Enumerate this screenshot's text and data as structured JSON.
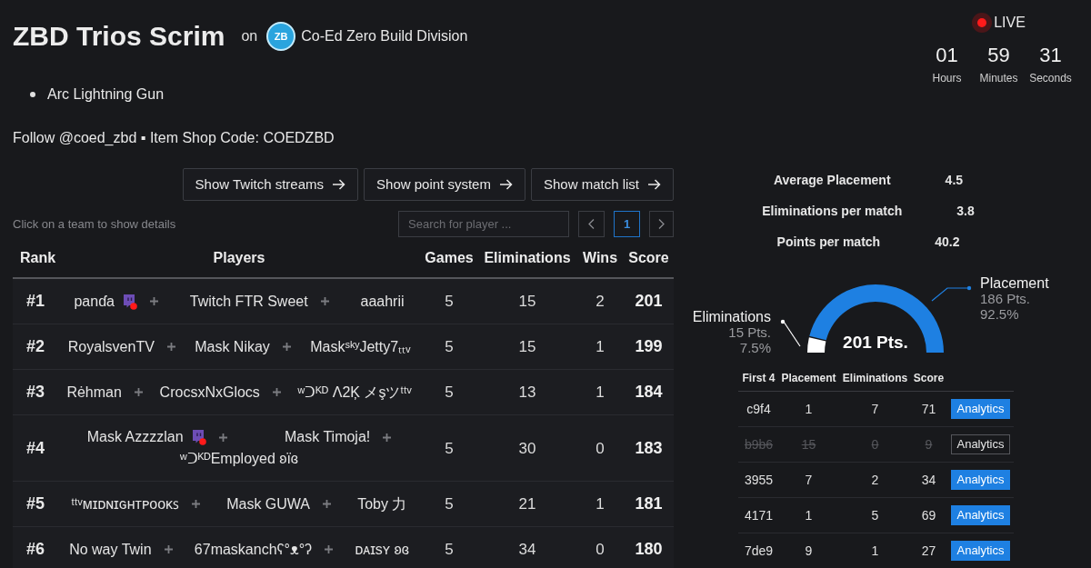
{
  "header": {
    "title": "ZBD Trios Scrim",
    "connector": "on",
    "organizer": {
      "logo_text": "ZB",
      "name": "Co-Ed Zero Build Division"
    }
  },
  "live": {
    "label": "LIVE"
  },
  "countdown": [
    {
      "value": "01",
      "unit": "Hours"
    },
    {
      "value": "59",
      "unit": "Minutes"
    },
    {
      "value": "31",
      "unit": "Seconds"
    }
  ],
  "notes": [
    "Arc Lightning Gun"
  ],
  "follow_line": "Follow @coed_zbd ▪ Item Shop Code: COEDZBD",
  "actions": [
    "Show Twitch streams",
    "Show point system",
    "Show match list"
  ],
  "hint": "Click on a team to show details",
  "search": {
    "placeholder": "Search for player ..."
  },
  "pagination": [
    {
      "label": "1",
      "selected": true
    }
  ],
  "leaderboard": {
    "columns": [
      "Rank",
      "Players",
      "Games",
      "Eliminations",
      "Wins",
      "Score"
    ],
    "rows": [
      {
        "rank": "#1",
        "players": [
          {
            "name": "panɗa",
            "live": true
          },
          {
            "name": "Twitch FTR Sweet",
            "live": false
          },
          {
            "name": "aaahrii",
            "live": false
          }
        ],
        "games": "5",
        "eliminations": "15",
        "wins": "2",
        "score": "201"
      },
      {
        "rank": "#2",
        "players": [
          {
            "name": "RoyalsvenTV",
            "live": false
          },
          {
            "name": "Mask Nikay",
            "live": false
          },
          {
            "name": "MaskˢᵏʸJetty7ₜₜᵥ",
            "live": false
          }
        ],
        "games": "5",
        "eliminations": "15",
        "wins": "1",
        "score": "199"
      },
      {
        "rank": "#3",
        "players": [
          {
            "name": "Rėhman",
            "live": false
          },
          {
            "name": "CrocsxNxGlocs",
            "live": false
          },
          {
            "name": "ʷᑐᴷᴰ Λ2Ķ メşツᵗᵗᵛ",
            "live": false
          }
        ],
        "games": "5",
        "eliminations": "13",
        "wins": "1",
        "score": "184"
      },
      {
        "rank": "#4",
        "players": [
          {
            "name": "Mask Azzzzlan",
            "live": true
          },
          {
            "name": "Mask Timoja!",
            "live": false
          },
          {
            "name": "ʷᑐᴷᴰEmployed ʚïɞ",
            "live": false
          }
        ],
        "games": "5",
        "eliminations": "30",
        "wins": "0",
        "score": "183"
      },
      {
        "rank": "#5",
        "players": [
          {
            "name": "ᵗᵗᵛᴍɪᴅɴɪɢʜᴛᴘᴏᴏᴋꜱ",
            "live": false
          },
          {
            "name": "Mask GUWA",
            "live": false
          },
          {
            "name": "Toby 力",
            "live": false
          }
        ],
        "games": "5",
        "eliminations": "21",
        "wins": "1",
        "score": "181"
      },
      {
        "rank": "#6",
        "players": [
          {
            "name": "No way Twin",
            "live": false
          },
          {
            "name": "67maskanchʕ°ᴥ°ʔ",
            "live": false
          },
          {
            "name": "ᴅᴀɪsʏ ʚɞ",
            "live": false
          }
        ],
        "games": "5",
        "eliminations": "34",
        "wins": "0",
        "score": "180"
      }
    ]
  },
  "team_stats": [
    {
      "label": "Average Placement",
      "value": "4.5"
    },
    {
      "label": "Eliminations per match",
      "value": "3.8"
    },
    {
      "label": "Points per match",
      "value": "40.2"
    }
  ],
  "score_chart": {
    "total": "201 Pts.",
    "callouts": [
      {
        "points": "15 Pts.",
        "share": "7.5%",
        "color": "#ffffff"
      },
      {
        "points": "186 Pts.",
        "share": "92.5%",
        "color": "#1e80e2"
      }
    ],
    "chart_data": {
      "type": "donut",
      "categories": [
        "Eliminations",
        "Placement"
      ],
      "values": [
        7.5,
        92.5
      ]
    }
  },
  "matches": {
    "columns": [
      "First 4",
      "Placement",
      "Eliminations",
      "Score"
    ],
    "rows": [
      {
        "first_4": "c9f4",
        "placement": "1",
        "eliminations": "7",
        "score": "71",
        "action": "Analytics",
        "disabled": false
      },
      {
        "first_4": "b9b6",
        "placement": "15",
        "eliminations": "0",
        "score": "9",
        "action": "Analytics",
        "disabled": true
      },
      {
        "first_4": "3955",
        "placement": "7",
        "eliminations": "2",
        "score": "34",
        "action": "Analytics",
        "disabled": false
      },
      {
        "first_4": "4171",
        "placement": "1",
        "eliminations": "5",
        "score": "69",
        "action": "Analytics",
        "disabled": false
      },
      {
        "first_4": "7de9",
        "placement": "9",
        "eliminations": "1",
        "score": "27",
        "action": "Analytics",
        "disabled": false
      }
    ]
  }
}
